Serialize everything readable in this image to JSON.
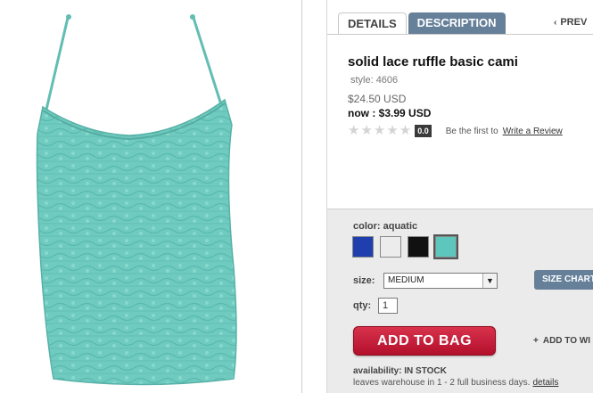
{
  "product": {
    "image_alt": "aquatic lace cami",
    "title": "solid lace ruffle basic cami",
    "style_label": "style:",
    "style_number": "4606",
    "original_price": "$24.50 USD",
    "now_price": "now : $3.99 USD",
    "rating_stars": "★★★★★",
    "rating_score": "0.0",
    "be_first": "Be the first to",
    "write_review": "Write a Review"
  },
  "tabs": {
    "details": "DETAILS",
    "description": "DESCRIPTION",
    "prev": "PREV"
  },
  "options": {
    "color_label": "color: aquatic",
    "swatches": [
      {
        "name": "blue",
        "color": "#1f3fae"
      },
      {
        "name": "white",
        "color": "#ececec"
      },
      {
        "name": "black",
        "color": "#111111"
      },
      {
        "name": "aquatic",
        "color": "#5dc6bd"
      }
    ],
    "size_label": "size:",
    "size_value": "MEDIUM",
    "size_chart": "SIZE CHART",
    "qty_label": "qty:",
    "qty_value": "1",
    "add_to_bag": "ADD TO BAG",
    "add_to_wishlist": "ADD TO WI",
    "availability": "availability: IN STOCK",
    "leaves_text": "leaves warehouse in 1 - 2 full business days.",
    "details_link": "details"
  },
  "colors": {
    "tab_blue": "#66809a",
    "bag_red": "#c41e3a",
    "cami": "#6ccabf"
  }
}
